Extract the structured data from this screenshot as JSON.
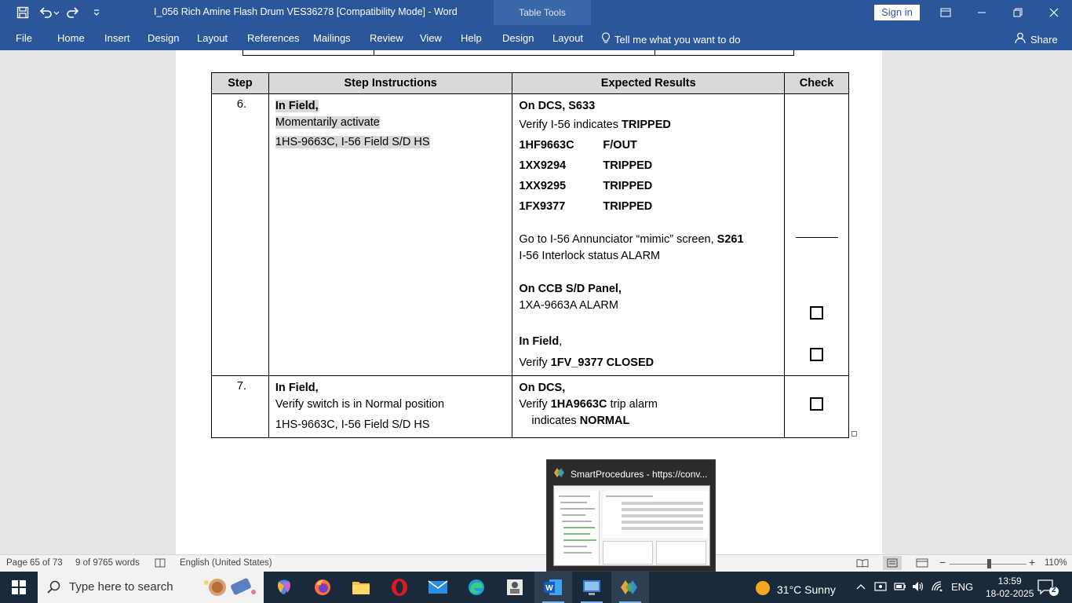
{
  "window": {
    "title": "I_056 Rich Amine Flash Drum VES36278 [Compatibility Mode]  -  Word",
    "table_tools_label": "Table Tools",
    "sign_in_label": "Sign in"
  },
  "ribbon": {
    "tabs": [
      "File",
      "Home",
      "Insert",
      "Design",
      "Layout",
      "References",
      "Mailings",
      "Review",
      "View",
      "Help",
      "Design",
      "Layout"
    ],
    "tell_me": "Tell me what you want to do",
    "share": "Share"
  },
  "table": {
    "headers": {
      "step": "Step",
      "instructions": "Step Instructions",
      "expected": "Expected Results",
      "check": "Check"
    },
    "step6": {
      "number": "6.",
      "instr_line1": "In Field,",
      "instr_line2": "Momentarily activate",
      "instr_line3": "1HS-9663C, I-56 Field S/D HS",
      "dcs_label": "On DCS",
      "dcs_screen": "S633",
      "verify_prefix": "Verify I-56   indicates ",
      "verify_value": "TRIPPED",
      "io": [
        {
          "tag": "1HF9663C",
          "value": "F/OUT"
        },
        {
          "tag": "1XX9294",
          "value": "TRIPPED"
        },
        {
          "tag": "1XX9295",
          "value": "TRIPPED"
        },
        {
          "tag": "1FX9377",
          "value": "TRIPPED"
        }
      ],
      "annunciator_text": "Go to I-56 Annunciator “mimic” screen, ",
      "annunciator_screen": "S261",
      "interlock_text": "I-56 Interlock status ALARM",
      "ccb_label": "On CCB S/D Panel,",
      "ccb_alarm": "1XA-9663A ALARM",
      "field_label": "In Field",
      "field_verify_prefix": "Verify ",
      "field_verify_value": "1FV_9377 CLOSED"
    },
    "step7": {
      "number": "7.",
      "instr_line1": "In Field,",
      "instr_line2": "Verify switch is in Normal position",
      "instr_line3": "1HS-9663C, I-56 Field S/D HS",
      "dcs_label": "On DCS,",
      "verify_prefix": "Verify ",
      "verify_tag": "1HA9663C",
      "verify_suffix": " trip alarm",
      "indicates_prefix": "indicates ",
      "indicates_value": "NORMAL"
    }
  },
  "thumbnail": {
    "title": "SmartProcedures - https://conv..."
  },
  "statusbar": {
    "page": "Page 65 of 73",
    "words": "9 of 9765 words",
    "language": "English (United States)",
    "zoom": "110%"
  },
  "taskbar": {
    "search_placeholder": "Type here to search",
    "weather_temp": "31°C  Sunny",
    "lang": "ENG",
    "time": "13:59",
    "date": "18-02-2025",
    "notification_count": "2"
  },
  "colors": {
    "word_blue": "#2b579a",
    "header_gray": "#d9d9d9",
    "taskbar": "#1b2a3a"
  }
}
